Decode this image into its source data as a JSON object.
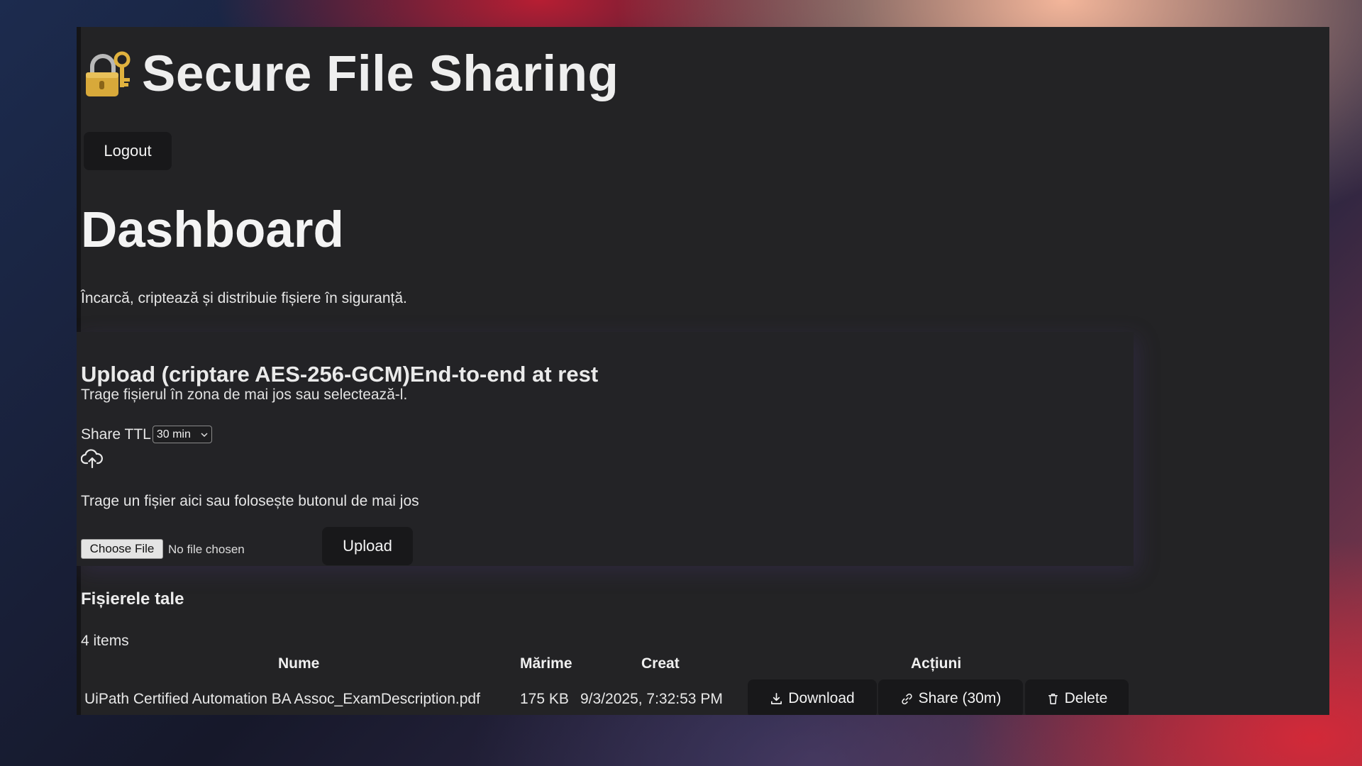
{
  "app": {
    "title": "Secure File Sharing",
    "logout_label": "Logout"
  },
  "icons": {
    "header": "lock-with-key-icon",
    "upload": "cloud-upload-icon",
    "download": "download-icon",
    "share": "link-icon",
    "delete": "trash-icon",
    "select_chevron": "chevron-down-icon"
  },
  "dashboard": {
    "title": "Dashboard",
    "subtitle": "Încarcă, criptează și distribuie fișiere în siguranță."
  },
  "upload": {
    "heading": "Upload (criptare AES-256-GCM)End-to-end at rest",
    "hint": "Trage fișierul în zona de mai jos sau selectează-l.",
    "ttl_label": "Share TTL",
    "ttl_value": "30 min",
    "drop_text": "Trage un fișier aici sau folosește butonul de mai jos",
    "choose_file_label": "Choose File",
    "no_file_text": "No file chosen",
    "upload_label": "Upload"
  },
  "files": {
    "heading": "Fișierele tale",
    "count": "4 items",
    "columns": {
      "name": "Nume",
      "size": "Mărime",
      "created": "Creat",
      "actions": "Acțiuni"
    },
    "rows": [
      {
        "name": "UiPath Certified Automation BA Assoc_ExamDescription.pdf",
        "size": "175 KB",
        "created": "9/3/2025, 7:32:53 PM",
        "download_label": "Download",
        "share_label": "Share (30m)",
        "delete_label": "Delete"
      }
    ]
  },
  "colors": {
    "window_bg": "#232325",
    "button_bg": "#18181a",
    "text": "#f2f2f2"
  }
}
